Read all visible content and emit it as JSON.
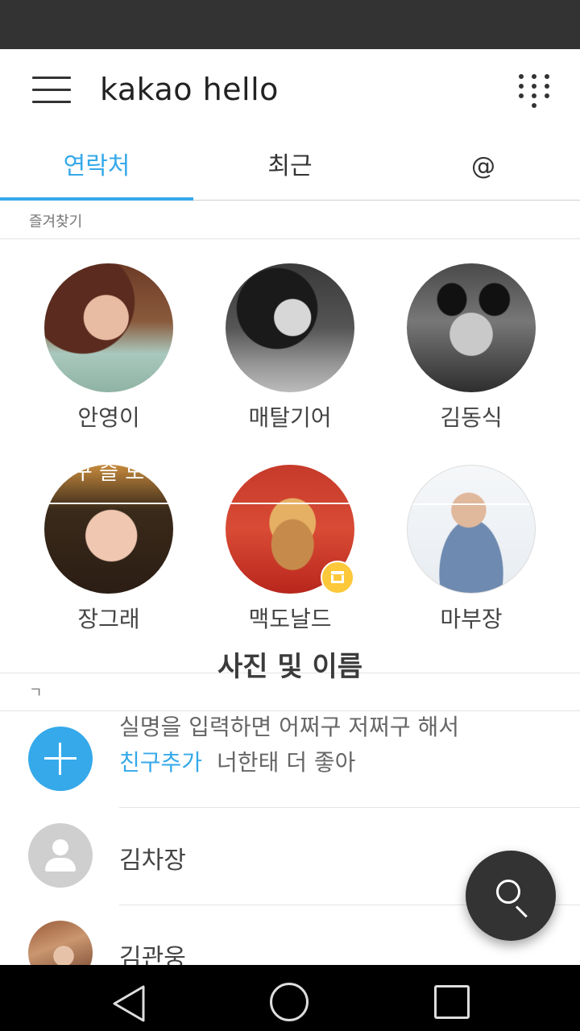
{
  "app_bar": {
    "title": "kakao hello",
    "menu_icon": "hamburger-menu-icon",
    "grid_icon": "dialpad-grid-icon"
  },
  "tabs": [
    {
      "label": "연락처",
      "active": true
    },
    {
      "label": "최근",
      "active": false
    },
    {
      "label": "@",
      "active": false
    }
  ],
  "colors": {
    "accent": "#35a9ea",
    "dark": "#333333",
    "badge": "#fdc839"
  },
  "favorites": {
    "section_label": "즐겨찾기",
    "items": [
      {
        "name": "안영이"
      },
      {
        "name": "매탈기어"
      },
      {
        "name": "김동식"
      },
      {
        "name": "장그래",
        "overlay_text": "구 슬 모"
      },
      {
        "name": "맥도날드",
        "badge": "store-icon"
      },
      {
        "name": "마부장"
      }
    ]
  },
  "caption": "사진 및 이름",
  "contacts": {
    "section_label": "ㄱ",
    "add_friend": {
      "line1": "실명을 입력하면 어쩌구 저쩌구 해서",
      "link": "친구추가",
      "line2_rest": "너한태 더 좋아"
    },
    "items": [
      {
        "name": "김차장",
        "avatar": "default-person-icon"
      },
      {
        "name": "김관웅",
        "avatar": "photo"
      }
    ]
  },
  "fab": {
    "icon": "search-icon"
  },
  "nav": {
    "back": "back-icon",
    "home": "home-icon",
    "recent": "recent-apps-icon"
  }
}
